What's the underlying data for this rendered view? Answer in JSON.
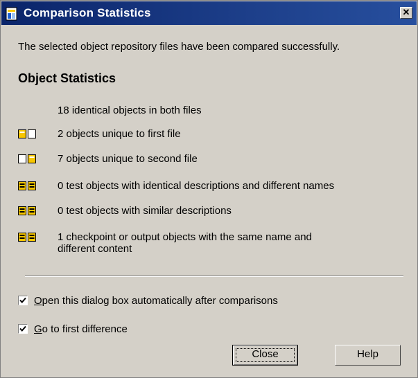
{
  "window": {
    "title": "Comparison Statistics",
    "close_glyph": "✕",
    "title_icon": "dialog-document-icon"
  },
  "message": "The selected object repository files have been compared successfully.",
  "section_title": "Object Statistics",
  "stats": [
    {
      "text": "18 identical objects in both files",
      "icon": "none"
    },
    {
      "text": "2 objects unique to first file",
      "icon": "unique-first-file-icon"
    },
    {
      "text": "7 objects unique to second file",
      "icon": "unique-second-file-icon"
    },
    {
      "text": "0 test objects with identical descriptions and different names",
      "icon": "identical-descriptions-icon"
    },
    {
      "text": "0 test objects with similar descriptions",
      "icon": "similar-descriptions-icon"
    },
    {
      "text": "1 checkpoint or output objects with the same name and",
      "text_line2": "different content",
      "icon": "checkpoint-output-icon"
    }
  ],
  "options": {
    "open_dialog": {
      "prefix": "",
      "mnemonic": "O",
      "rest": "pen this dialog box automatically after comparisons",
      "checked": true
    },
    "go_first": {
      "prefix": "",
      "mnemonic": "G",
      "rest": "o to first difference",
      "checked": true
    }
  },
  "buttons": {
    "close": "Close",
    "help": "Help"
  },
  "colors": {
    "titlebar": "#0a246a",
    "dialog_bg": "#d4d0c8",
    "icon_yellow": "#f7c600"
  }
}
